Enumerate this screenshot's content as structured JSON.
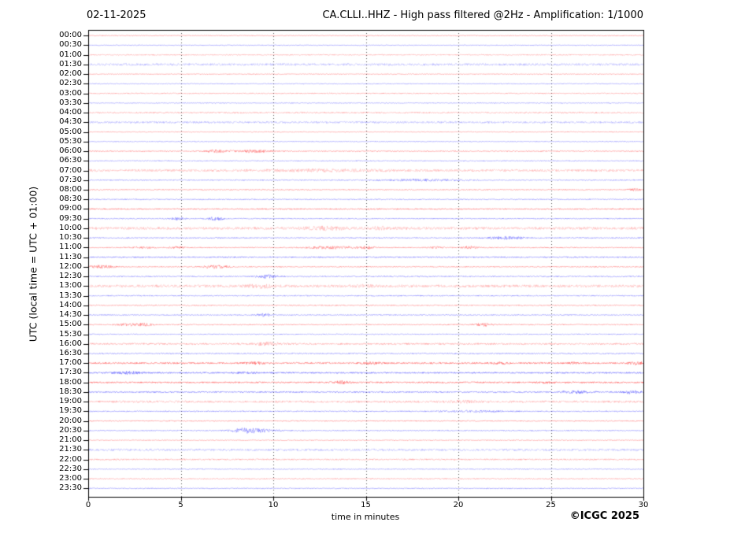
{
  "chart_data": {
    "type": "line",
    "subtype": "helicorder-seismogram",
    "date": "02-11-2025",
    "title": "CA.CLLI..HHZ - High pass filtered @2Hz - Amplification: 1/1000",
    "ylabel": "UTC (local time = UTC + 01:00)",
    "xlabel": "time in minutes",
    "copyright": "©ICGC 2025",
    "xlim": [
      0,
      30
    ],
    "x_ticks": [
      0,
      5,
      10,
      15,
      20,
      25,
      30
    ],
    "gridlines_minutes": [
      5,
      10,
      15,
      20,
      25
    ],
    "grid_on": true,
    "legend": "none",
    "colors": {
      "red": "#ff2020",
      "blue": "#2424ff",
      "frame": "#000000",
      "grid": "#555555"
    },
    "layout": {
      "plot_left": 112,
      "plot_right": 817,
      "plot_top": 38,
      "plot_bottom": 631,
      "row0_y": 45.2,
      "row_spacing": 12.236
    },
    "rows": [
      {
        "label": "00:00",
        "color": "red",
        "noise": 0.45,
        "alpha": 0.55,
        "events": []
      },
      {
        "label": "00:30",
        "color": "blue",
        "noise": 0.45,
        "alpha": 0.55,
        "events": []
      },
      {
        "label": "01:00",
        "color": "red",
        "noise": 0.7,
        "alpha": 0.4,
        "events": []
      },
      {
        "label": "01:30",
        "color": "blue",
        "noise": 1.5,
        "alpha": 0.28,
        "events": []
      },
      {
        "label": "02:00",
        "color": "red",
        "noise": 0.5,
        "alpha": 0.5,
        "events": []
      },
      {
        "label": "02:30",
        "color": "blue",
        "noise": 0.5,
        "alpha": 0.5,
        "events": []
      },
      {
        "label": "03:00",
        "color": "red",
        "noise": 0.6,
        "alpha": 0.45,
        "events": []
      },
      {
        "label": "03:30",
        "color": "blue",
        "noise": 0.5,
        "alpha": 0.5,
        "events": []
      },
      {
        "label": "04:00",
        "color": "red",
        "noise": 0.9,
        "alpha": 0.38,
        "events": []
      },
      {
        "label": "04:30",
        "color": "blue",
        "noise": 1.3,
        "alpha": 0.3,
        "events": []
      },
      {
        "label": "05:00",
        "color": "red",
        "noise": 0.5,
        "alpha": 0.5,
        "events": []
      },
      {
        "label": "05:30",
        "color": "blue",
        "noise": 0.5,
        "alpha": 0.5,
        "events": []
      },
      {
        "label": "06:00",
        "color": "red",
        "noise": 0.6,
        "alpha": 0.55,
        "events": [
          [
            7,
            1.6,
            0.5
          ],
          [
            9,
            1.6,
            0.6
          ]
        ]
      },
      {
        "label": "06:30",
        "color": "blue",
        "noise": 0.6,
        "alpha": 0.5,
        "events": []
      },
      {
        "label": "07:00",
        "color": "red",
        "noise": 1.6,
        "alpha": 0.28,
        "events": [
          [
            13,
            0.8,
            2
          ]
        ]
      },
      {
        "label": "07:30",
        "color": "blue",
        "noise": 0.7,
        "alpha": 0.5,
        "events": [
          [
            18.2,
            1.1,
            1.5
          ]
        ]
      },
      {
        "label": "08:00",
        "color": "red",
        "noise": 0.6,
        "alpha": 0.55,
        "events": [
          [
            29.6,
            1.4,
            0.3
          ]
        ]
      },
      {
        "label": "08:30",
        "color": "blue",
        "noise": 0.6,
        "alpha": 0.55,
        "events": []
      },
      {
        "label": "09:00",
        "color": "red",
        "noise": 0.8,
        "alpha": 0.6,
        "events": []
      },
      {
        "label": "09:30",
        "color": "blue",
        "noise": 0.6,
        "alpha": 0.55,
        "events": [
          [
            4.8,
            1.8,
            0.25
          ],
          [
            6.9,
            2.2,
            0.3
          ]
        ]
      },
      {
        "label": "10:00",
        "color": "red",
        "noise": 1.7,
        "alpha": 0.28,
        "events": [
          [
            12.8,
            1.5,
            0.8
          ],
          [
            15.9,
            1.2,
            0.5
          ]
        ]
      },
      {
        "label": "10:30",
        "color": "blue",
        "noise": 0.7,
        "alpha": 0.55,
        "events": [
          [
            22.6,
            1.6,
            0.7
          ]
        ]
      },
      {
        "label": "11:00",
        "color": "red",
        "noise": 0.6,
        "alpha": 0.55,
        "events": [
          [
            3,
            1.2,
            0.4
          ],
          [
            4.8,
            1.3,
            0.3
          ],
          [
            13.2,
            1.6,
            1.0
          ],
          [
            15.1,
            1.4,
            0.3
          ],
          [
            18.8,
            1.0,
            0.3
          ],
          [
            20.6,
            1.8,
            0.3
          ]
        ]
      },
      {
        "label": "11:30",
        "color": "blue",
        "noise": 0.8,
        "alpha": 0.6,
        "events": []
      },
      {
        "label": "12:00",
        "color": "red",
        "noise": 0.6,
        "alpha": 0.55,
        "events": [
          [
            0.7,
            1.8,
            0.5
          ],
          [
            6.9,
            2.0,
            0.5
          ]
        ]
      },
      {
        "label": "12:30",
        "color": "blue",
        "noise": 0.7,
        "alpha": 0.55,
        "events": [
          [
            9.7,
            2.0,
            0.4
          ]
        ]
      },
      {
        "label": "13:00",
        "color": "red",
        "noise": 1.7,
        "alpha": 0.28,
        "events": [
          [
            9.3,
            1.8,
            0.5
          ],
          [
            14.9,
            0.9,
            0.4
          ]
        ]
      },
      {
        "label": "13:30",
        "color": "blue",
        "noise": 0.7,
        "alpha": 0.5,
        "events": []
      },
      {
        "label": "14:00",
        "color": "red",
        "noise": 0.7,
        "alpha": 0.5,
        "events": []
      },
      {
        "label": "14:30",
        "color": "blue",
        "noise": 0.6,
        "alpha": 0.55,
        "events": [
          [
            9.5,
            1.8,
            0.3
          ]
        ]
      },
      {
        "label": "15:00",
        "color": "red",
        "noise": 0.6,
        "alpha": 0.55,
        "events": [
          [
            2.2,
            1.4,
            0.5
          ],
          [
            3.1,
            1.2,
            0.3
          ],
          [
            21.4,
            1.8,
            0.35
          ]
        ]
      },
      {
        "label": "15:30",
        "color": "blue",
        "noise": 0.6,
        "alpha": 0.5,
        "events": []
      },
      {
        "label": "16:00",
        "color": "red",
        "noise": 1.1,
        "alpha": 0.4,
        "events": [
          [
            9.7,
            1.6,
            0.5
          ]
        ]
      },
      {
        "label": "16:30",
        "color": "blue",
        "noise": 0.7,
        "alpha": 0.55,
        "events": []
      },
      {
        "label": "17:00",
        "color": "red",
        "noise": 1.0,
        "alpha": 0.7,
        "events": [
          [
            9,
            1.0,
            0.4
          ],
          [
            15.3,
            1.0,
            0.4
          ],
          [
            22.3,
            0.9,
            0.4
          ],
          [
            26.3,
            0.8,
            0.3
          ],
          [
            29.6,
            1.6,
            0.3
          ]
        ]
      },
      {
        "label": "17:30",
        "color": "blue",
        "noise": 0.9,
        "alpha": 0.7,
        "events": [
          [
            2.1,
            1.2,
            0.6
          ],
          [
            8.6,
            0.8,
            0.4
          ]
        ]
      },
      {
        "label": "18:00",
        "color": "red",
        "noise": 0.9,
        "alpha": 0.7,
        "events": [
          [
            13.7,
            1.5,
            0.3
          ],
          [
            24.8,
            0.8,
            0.3
          ]
        ]
      },
      {
        "label": "18:30",
        "color": "blue",
        "noise": 0.8,
        "alpha": 0.65,
        "events": [
          [
            26.3,
            1.4,
            0.6
          ],
          [
            29.3,
            1.6,
            0.4
          ]
        ]
      },
      {
        "label": "19:00",
        "color": "red",
        "noise": 1.4,
        "alpha": 0.3,
        "events": [
          [
            20.3,
            0.9,
            0.5
          ]
        ]
      },
      {
        "label": "19:30",
        "color": "blue",
        "noise": 0.7,
        "alpha": 0.55,
        "events": [
          [
            20.8,
            0.9,
            1.2
          ]
        ]
      },
      {
        "label": "20:00",
        "color": "red",
        "noise": 0.6,
        "alpha": 0.55,
        "events": []
      },
      {
        "label": "20:30",
        "color": "blue",
        "noise": 0.6,
        "alpha": 0.55,
        "events": [
          [
            8.4,
            2.4,
            0.5
          ],
          [
            9.3,
            1.6,
            0.7
          ]
        ]
      },
      {
        "label": "21:00",
        "color": "red",
        "noise": 0.5,
        "alpha": 0.5,
        "events": []
      },
      {
        "label": "21:30",
        "color": "blue",
        "noise": 1.5,
        "alpha": 0.28,
        "events": []
      },
      {
        "label": "22:00",
        "color": "red",
        "noise": 0.9,
        "alpha": 0.4,
        "events": []
      },
      {
        "label": "22:30",
        "color": "blue",
        "noise": 0.55,
        "alpha": 0.5,
        "events": []
      },
      {
        "label": "23:00",
        "color": "red",
        "noise": 0.6,
        "alpha": 0.45,
        "events": []
      },
      {
        "label": "23:30",
        "color": "blue",
        "noise": 0.55,
        "alpha": 0.55,
        "events": []
      }
    ]
  }
}
